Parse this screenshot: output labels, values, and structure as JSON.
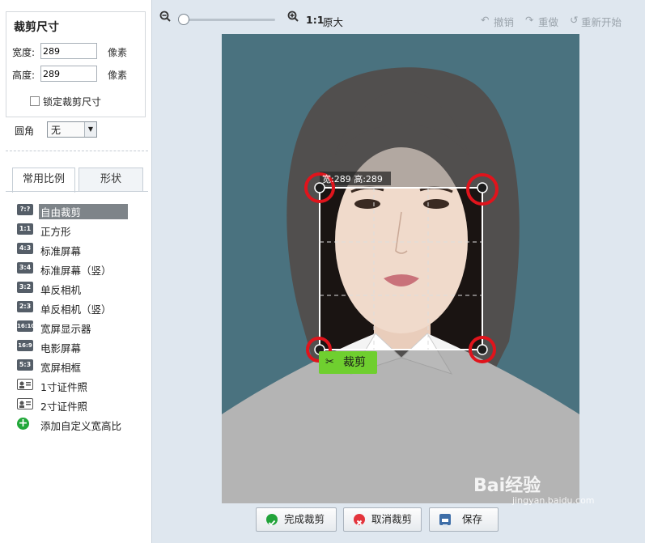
{
  "crop_size": {
    "title": "裁剪尺寸",
    "width_label": "宽度:",
    "width_value": "289",
    "height_label": "高度:",
    "height_value": "289",
    "unit": "像素",
    "lock_label": "锁定裁剪尺寸",
    "lock_checked": false
  },
  "corner": {
    "label": "圆角",
    "value": "无"
  },
  "tabs": [
    {
      "label": "常用比例"
    },
    {
      "label": "形状"
    }
  ],
  "ratios": [
    {
      "icon": "?:?",
      "label": "自由裁剪",
      "selected": true
    },
    {
      "icon": "1:1",
      "label": "正方形"
    },
    {
      "icon": "4:3",
      "label": "标准屏幕"
    },
    {
      "icon": "3:4",
      "label": "标准屏幕（竖）"
    },
    {
      "icon": "3:2",
      "label": "单反相机"
    },
    {
      "icon": "2:3",
      "label": "单反相机（竖）"
    },
    {
      "icon": "16:10",
      "label": "宽屏显示器"
    },
    {
      "icon": "16:9",
      "label": "电影屏幕"
    },
    {
      "icon": "5:3",
      "label": "宽屏相框"
    },
    {
      "icon": "id-card-icon",
      "label": "1寸证件照"
    },
    {
      "icon": "id-card-icon",
      "label": "2寸证件照"
    },
    {
      "icon": "plus-icon",
      "label": "添加自定义宽高比"
    }
  ],
  "toolbar": {
    "zoom_1to1": "1:1",
    "original_size": "原大",
    "undo": "撤销",
    "redo": "重做",
    "restart": "重新开始",
    "zoom_level": 0
  },
  "crop": {
    "size_label": "宽:289 高:289",
    "crop_button": "裁剪"
  },
  "actions": {
    "done": "完成裁剪",
    "cancel": "取消裁剪",
    "save": "保存"
  },
  "watermark": {
    "text": "Bai经验",
    "url": "jingyan.baidu.com"
  },
  "colors": {
    "photo_bg": "#0a627e",
    "crop_green": "#6fcf2f",
    "annotation_red": "#e0141c",
    "selected_row": "#7e8489"
  }
}
